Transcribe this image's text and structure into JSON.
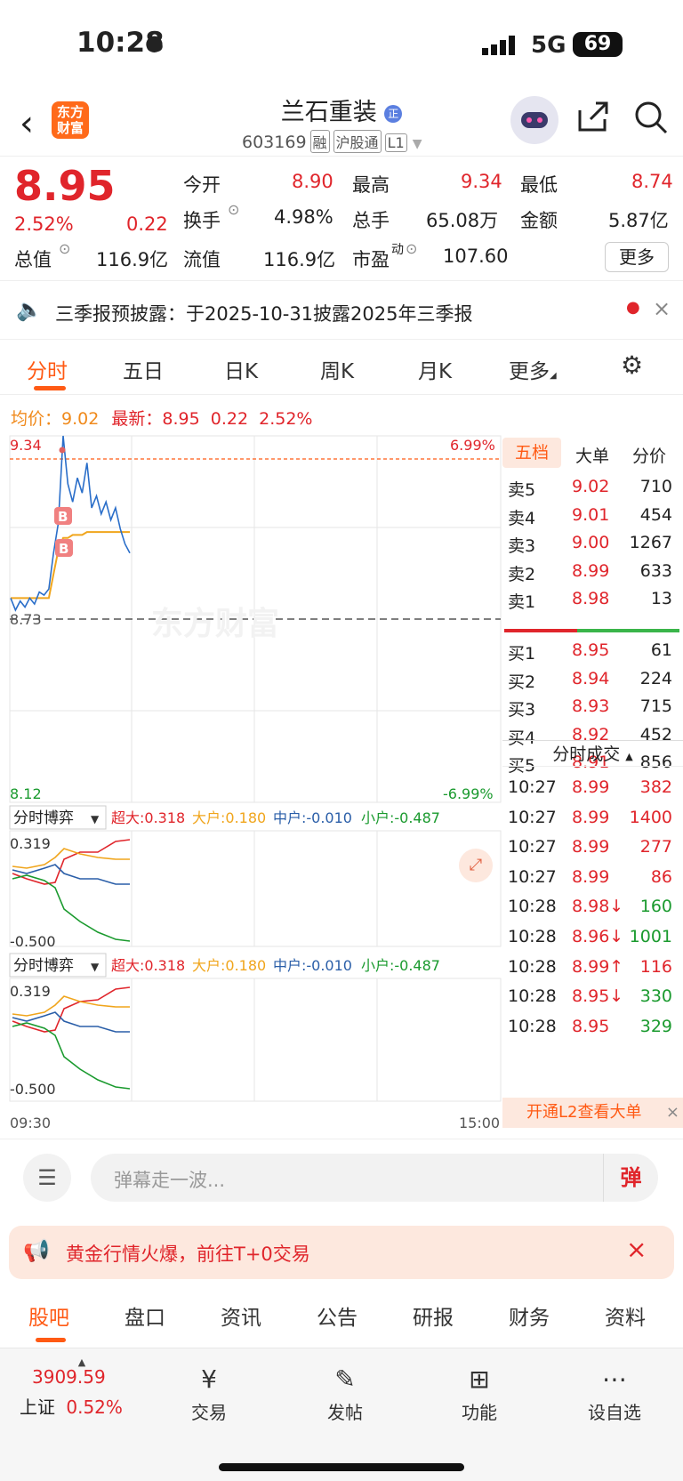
{
  "status": {
    "time": "10:28",
    "network": "5G",
    "battery": "69"
  },
  "header": {
    "logo": "东方财富",
    "title": "兰石重装",
    "code": "603169",
    "tags": [
      "融",
      "沪股通",
      "L1"
    ]
  },
  "quote": {
    "price": "8.95",
    "pct": "2.52%",
    "chg": "0.22",
    "fields": [
      {
        "label": "今开",
        "value": "8.90"
      },
      {
        "label": "最高",
        "value": "9.34"
      },
      {
        "label": "最低",
        "value": "8.74"
      },
      {
        "label": "换手",
        "value": "4.98%"
      },
      {
        "label": "总手",
        "value": "65.08万"
      },
      {
        "label": "金额",
        "value": "5.87亿"
      },
      {
        "label": "总值",
        "value": "116.9亿"
      },
      {
        "label": "流值",
        "value": "116.9亿"
      },
      {
        "label": "市盈",
        "value": "107.60",
        "sup": "动"
      }
    ],
    "more": "更多"
  },
  "notice": {
    "text": "三季报预披露：于2025-10-31披露2025年三季报"
  },
  "tabs": [
    "分时",
    "五日",
    "日K",
    "周K",
    "月K",
    "更多"
  ],
  "avg": {
    "avg_label": "均价：",
    "avg": "9.02",
    "latest_label": "最新：",
    "latest": "8.95",
    "chg": "0.22",
    "pct": "2.52%"
  },
  "chart": {
    "high": "9.34",
    "low": "8.12",
    "pre": "8.73",
    "up_pct": "6.99%",
    "down_pct": "-6.99%",
    "start": "09:30",
    "end": "15:00",
    "watermark": "东方财富",
    "panel_title": "分时博弈",
    "legend": [
      {
        "label": "超大:0.318",
        "color": "#e0252b"
      },
      {
        "label": "大户:0.180",
        "color": "#f0a51c"
      },
      {
        "label": "中户:-0.010",
        "color": "#2a5ea8"
      },
      {
        "label": "小户:-0.487",
        "color": "#1a9a2e"
      }
    ],
    "panel_max": "0.319",
    "panel_min": "-0.500"
  },
  "chart_data": {
    "type": "line",
    "x_range": [
      "09:30",
      "15:00"
    ],
    "ylim": [
      8.12,
      9.34
    ],
    "prev_close": 8.73,
    "series": [
      {
        "values": [
          8.8,
          8.76,
          8.79,
          8.77,
          8.8,
          8.78,
          8.82,
          8.81,
          8.83,
          8.95,
          9.05,
          9.34,
          9.18,
          9.12,
          9.2,
          9.15,
          9.25,
          9.1,
          9.14,
          9.08,
          9.12,
          9.06,
          9.1,
          9.03,
          8.98,
          8.95
        ]
      },
      {
        "values": [
          8.8,
          8.8,
          8.8,
          8.8,
          8.8,
          8.8,
          8.8,
          8.8,
          8.8,
          8.88,
          8.96,
          9.0,
          9.0,
          9.01,
          9.01,
          9.01,
          9.02,
          9.02,
          9.02,
          9.02,
          9.02,
          9.02,
          9.02,
          9.02,
          9.02,
          9.02
        ]
      }
    ]
  },
  "book": {
    "tabs": [
      "五档",
      "大单",
      "分价"
    ],
    "asks": [
      {
        "label": "卖5",
        "price": "9.02",
        "vol": "710"
      },
      {
        "label": "卖4",
        "price": "9.01",
        "vol": "454"
      },
      {
        "label": "卖3",
        "price": "9.00",
        "vol": "1267"
      },
      {
        "label": "卖2",
        "price": "8.99",
        "vol": "633"
      },
      {
        "label": "卖1",
        "price": "8.98",
        "vol": "13"
      }
    ],
    "bids": [
      {
        "label": "买1",
        "price": "8.95",
        "vol": "61"
      },
      {
        "label": "买2",
        "price": "8.94",
        "vol": "224"
      },
      {
        "label": "买3",
        "price": "8.93",
        "vol": "715"
      },
      {
        "label": "买4",
        "price": "8.92",
        "vol": "452"
      },
      {
        "label": "买5",
        "price": "8.91",
        "vol": "856"
      }
    ],
    "trades_title": "分时成交",
    "trades": [
      {
        "t": "10:27",
        "p": "8.99",
        "v": "382"
      },
      {
        "t": "10:27",
        "p": "8.99",
        "v": "1400"
      },
      {
        "t": "10:27",
        "p": "8.99",
        "v": "277"
      },
      {
        "t": "10:27",
        "p": "8.99",
        "v": "86"
      },
      {
        "t": "10:28",
        "p": "8.98↓",
        "v": "160"
      },
      {
        "t": "10:28",
        "p": "8.96↓",
        "v": "1001"
      },
      {
        "t": "10:28",
        "p": "8.99↑",
        "v": "116"
      },
      {
        "t": "10:28",
        "p": "8.95↓",
        "v": "330"
      },
      {
        "t": "10:28",
        "p": "8.95",
        "v": "329"
      }
    ],
    "l2": "开通L2查看大单"
  },
  "danmu": {
    "placeholder": "弹幕走一波...",
    "btn": "弹"
  },
  "promo": {
    "text": "黄金行情火爆，前往T+0交易"
  },
  "subtabs": [
    "股吧",
    "盘口",
    "资讯",
    "公告",
    "研报",
    "财务",
    "资料"
  ],
  "bottom": {
    "index_value": "3909.59",
    "index_name": "上证",
    "index_pct": "0.52%",
    "items": [
      "交易",
      "发帖",
      "功能",
      "设自选"
    ]
  }
}
